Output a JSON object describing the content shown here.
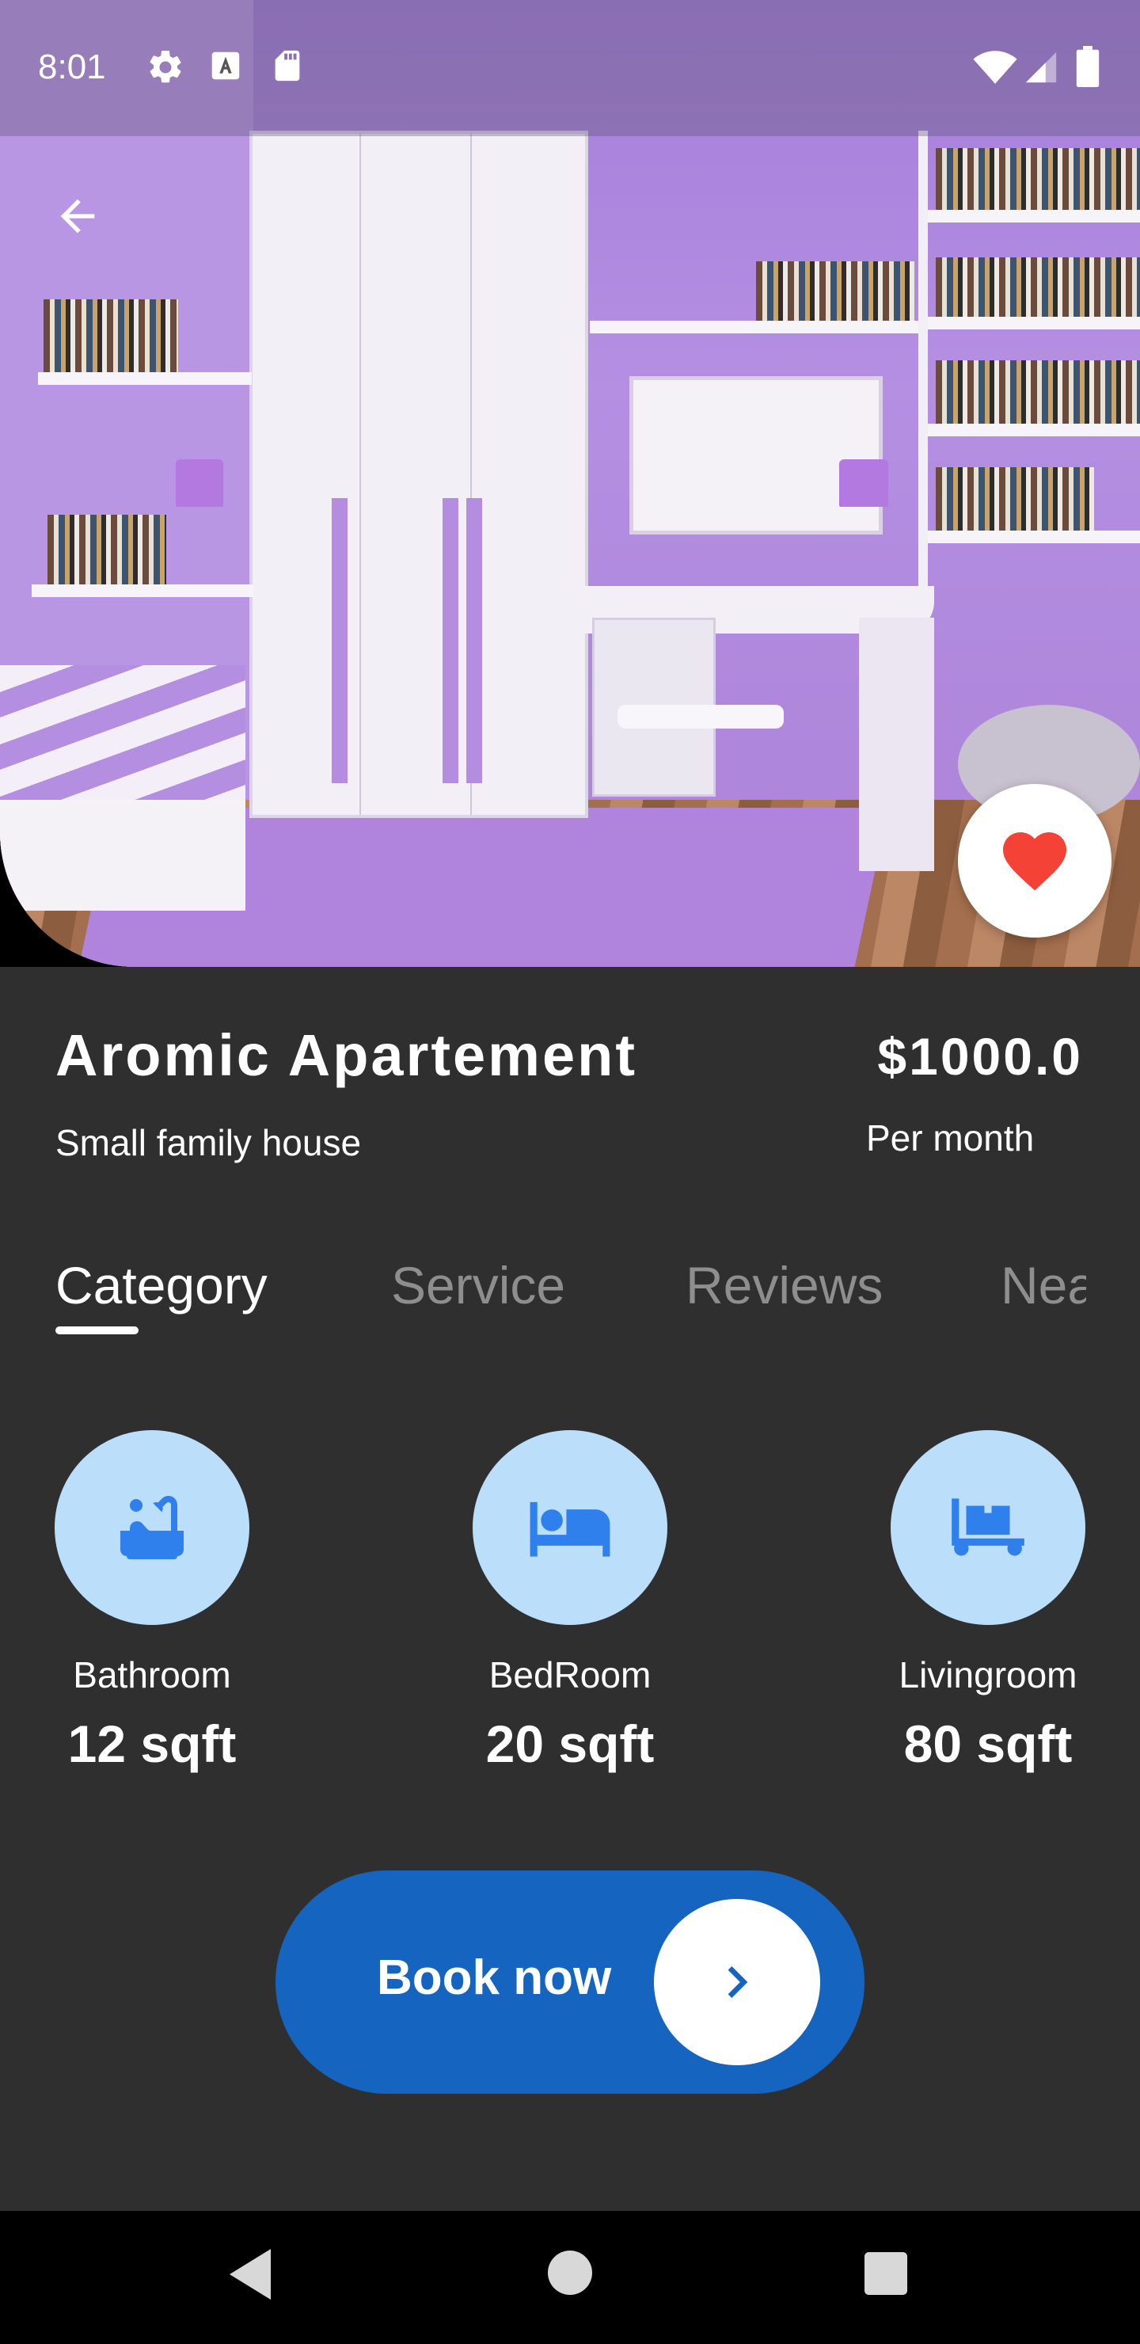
{
  "status_bar": {
    "time": "8:01",
    "icons": [
      "settings-icon",
      "text-a-icon",
      "sd-card-icon",
      "wifi-icon",
      "signal-icon",
      "battery-icon"
    ]
  },
  "hero": {
    "image": "purple-bedroom-photo",
    "back_icon": "arrow-left-icon",
    "favorite_icon": "heart-icon",
    "favorite_color": "#f44336"
  },
  "property": {
    "title": "Aromic Apartement",
    "subtitle": "Small family house",
    "price": "$1000.0",
    "price_period": "Per month"
  },
  "tabs": [
    {
      "label": "Category",
      "active": true
    },
    {
      "label": "Service",
      "active": false
    },
    {
      "label": "Reviews",
      "active": false
    },
    {
      "label": "Nea",
      "active": false
    }
  ],
  "categories": [
    {
      "label": "Bathroom",
      "size": "12 sqft",
      "icon": "bathtub-icon"
    },
    {
      "label": "BedRoom",
      "size": "20 sqft",
      "icon": "bed-icon"
    },
    {
      "label": "Livingroom",
      "size": "80 sqft",
      "icon": "sofa-icon"
    }
  ],
  "book": {
    "label": "Book now",
    "icon": "chevron-right-icon"
  },
  "nav_bar": {
    "icons": [
      "back-triangle-icon",
      "home-circle-icon",
      "recents-square-icon"
    ]
  },
  "colors": {
    "background": "#2f2f30",
    "accent": "#1565c0",
    "category_circle": "#bbdefb",
    "category_icon": "#2f80ed",
    "tab_inactive": "#8e8e8e"
  }
}
